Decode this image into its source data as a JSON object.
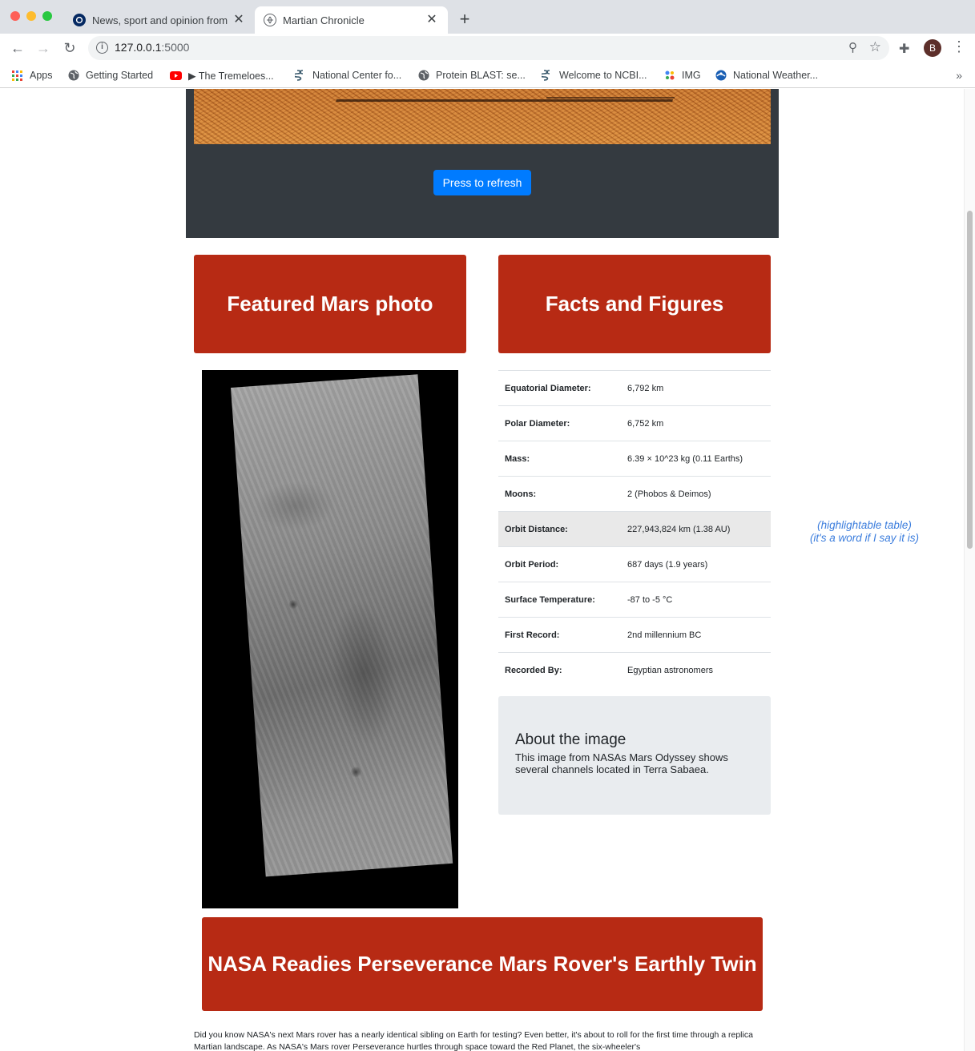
{
  "browser": {
    "tabs": [
      {
        "title": "News, sport and opinion from the Guardian"
      },
      {
        "title": "Martian Chronicle"
      }
    ],
    "new_tab_label": "+",
    "close_label": "✕",
    "address": {
      "host": "127.0.0.1",
      "port": ":5000"
    },
    "profile_initial": "B",
    "bookmarks": [
      {
        "label": "Apps",
        "icon": "apps-grid-icon"
      },
      {
        "label": "Getting Started",
        "icon": "globe-icon"
      },
      {
        "label": "▶ The Tremeloes...",
        "icon": "youtube-icon"
      },
      {
        "label": "National Center fo...",
        "icon": "ncbi-icon"
      },
      {
        "label": "Protein BLAST: se...",
        "icon": "globe-icon"
      },
      {
        "label": "Welcome to NCBI...",
        "icon": "ncbi-icon"
      },
      {
        "label": "IMG",
        "icon": "img-dots-icon"
      },
      {
        "label": "National Weather...",
        "icon": "noaa-icon"
      }
    ],
    "more_label": "»"
  },
  "page": {
    "refresh_button": "Press to refresh",
    "featured_header": "Featured Mars photo",
    "facts_header": "Facts and Figures",
    "facts": [
      {
        "label": "Equatorial Diameter:",
        "value": "6,792 km"
      },
      {
        "label": "Polar Diameter:",
        "value": "6,752 km"
      },
      {
        "label": "Mass:",
        "value": "6.39 × 10^23 kg (0.11 Earths)"
      },
      {
        "label": "Moons:",
        "value": "2 (Phobos & Deimos)"
      },
      {
        "label": "Orbit Distance:",
        "value": "227,943,824 km (1.38 AU)"
      },
      {
        "label": "Orbit Period:",
        "value": "687 days (1.9 years)"
      },
      {
        "label": "Surface Temperature:",
        "value": "-87 to -5 °C"
      },
      {
        "label": "First Record:",
        "value": "2nd millennium BC"
      },
      {
        "label": "Recorded By:",
        "value": "Egyptian astronomers"
      }
    ],
    "about": {
      "heading": "About the image",
      "text": "This image from NASAs Mars Odyssey shows several channels located in Terra Sabaea."
    },
    "table_note_line1": "(highlightable table)",
    "table_note_line2": "(it's a word if I say it is)",
    "news_title": "NASA Readies Perseverance Mars Rover's Earthly Twin",
    "news_paragraph": "Did you know NASA's next Mars rover has a nearly identical sibling on Earth for testing? Even better, it's about to roll for the first time through a replica Martian landscape. As NASA's Mars rover Perseverance hurtles through space toward the Red Planet, the six-wheeler's"
  }
}
